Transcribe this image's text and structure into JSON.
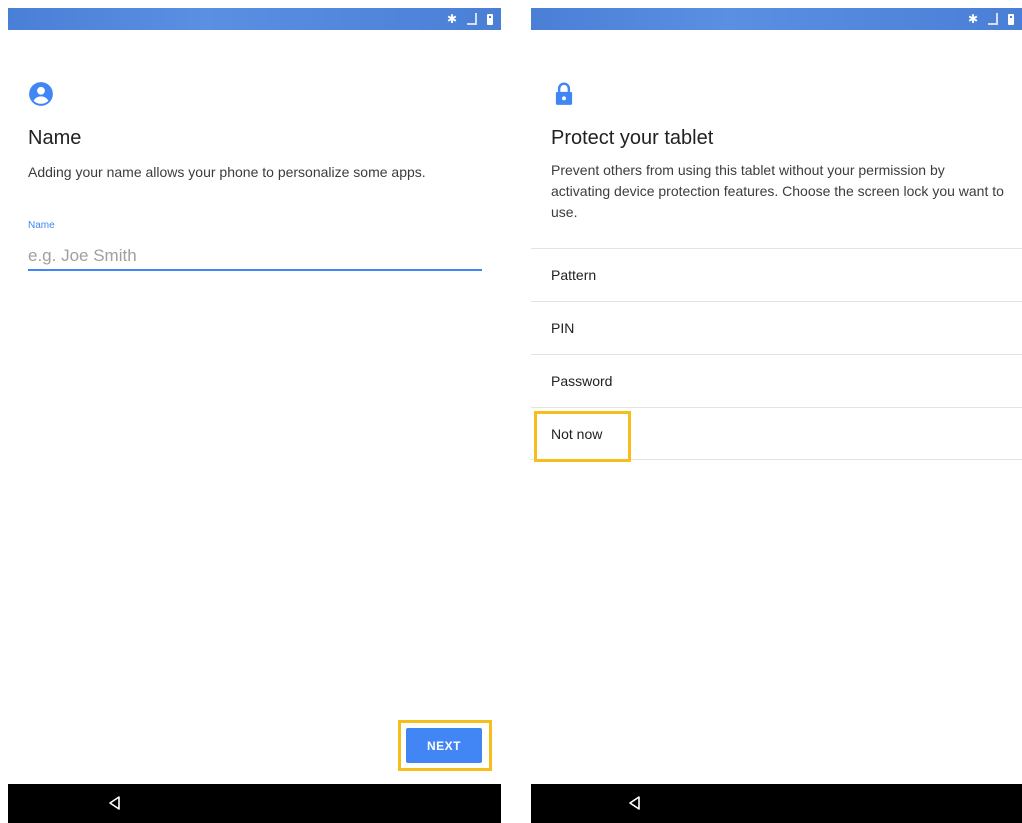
{
  "left_screen": {
    "title": "Name",
    "description": "Adding your name allows your phone to personalize some apps.",
    "field_label": "Name",
    "field_placeholder": "e.g. Joe Smith",
    "field_value": "",
    "next_label": "NEXT",
    "icon": "account-circle-icon"
  },
  "right_screen": {
    "title": "Protect your tablet",
    "description": "Prevent others from using this tablet without your permission by activating device protection features. Choose the screen lock you want to use.",
    "icon": "lock-icon",
    "options": [
      {
        "label": "Pattern"
      },
      {
        "label": "PIN"
      },
      {
        "label": "Password"
      },
      {
        "label": "Not now"
      }
    ]
  },
  "colors": {
    "accent": "#4285f4",
    "status_bar": "#4a7fd6",
    "highlight": "#f5be1b",
    "nav_bar": "#000000"
  }
}
